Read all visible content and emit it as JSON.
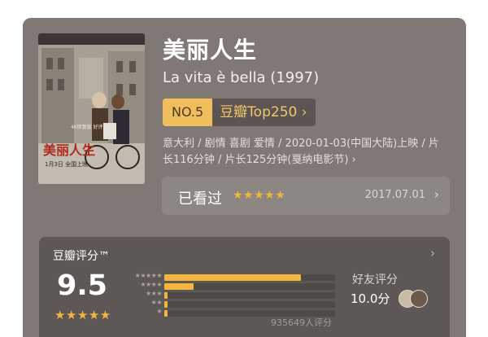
{
  "movie": {
    "title": "美丽人生",
    "original_title": "La vita è bella (1997)",
    "rank": {
      "number": "NO.5",
      "list": "豆瓣Top250 ›"
    },
    "meta": "意大利 / 剧情 喜剧 爱情 / 2020-01-03(中国大陆)上映 / 片长116分钟 / 片长125分钟(戛纳电影节) ›",
    "poster": {
      "title_text": "美丽人生",
      "date_text": "1月3日  全国上映",
      "top_text": "4K修复版  好评"
    }
  },
  "seen": {
    "label": "已看过",
    "stars": "★★★★★",
    "date": "2017.07.01",
    "chevron": "›"
  },
  "rating": {
    "title": "豆瓣评分™",
    "chevron": "›",
    "score": "9.5",
    "stars": "★★★★★",
    "distribution": [
      {
        "stars": "★★★★★",
        "value": 0.8
      },
      {
        "stars": "★★★★",
        "value": 0.17
      },
      {
        "stars": "★★★",
        "value": 0.02
      },
      {
        "stars": "★★",
        "value": 0.01
      },
      {
        "stars": "★",
        "value": 0.01
      }
    ],
    "count": "935649人评分",
    "friends": {
      "label": "好友评分",
      "score": "10.0分"
    }
  },
  "colors": {
    "accent": "#f3b540",
    "card": "#7f7874",
    "panel": "#5d5755"
  }
}
